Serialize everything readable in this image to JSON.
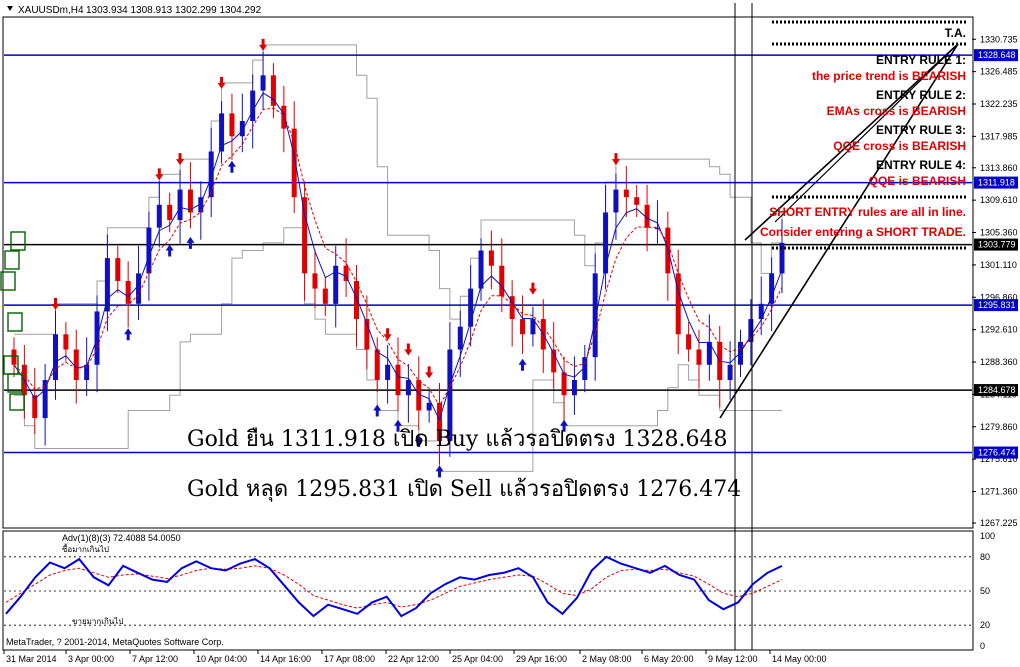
{
  "window": {
    "symbol_header": "XAUUSDm,H4",
    "ohlc": "1303.934 1308.913 1302.299 1304.292",
    "copyright": "MetaTrader, ? 2001-2014, MetaQuotes Software Corp."
  },
  "annotations": {
    "ta_label": "T.A.",
    "rules": [
      {
        "title": "ENTRY RULE 1:",
        "text": "the price trend is BEARISH"
      },
      {
        "title": "ENTRY RULE 2:",
        "text": "EMAs cross is BEARISH"
      },
      {
        "title": "ENTRY RULE 3:",
        "text": "QQE cross is BEARISH"
      },
      {
        "title": "ENTRY RULE 4:",
        "text": "QQE is BEARISH"
      }
    ],
    "short_entry_1": "SHORT ENTRY rules are all in line.",
    "short_entry_2": "Consider entering a SHORT TRADE.",
    "thai_line_1": "Gold ยืน 1311.918 เปิด Buy แล้วรอปิดตรง 1328.648",
    "thai_line_2": "Gold หลุด 1295.831 เปิด Sell แล้วรอปิดตรง 1276.474"
  },
  "colors": {
    "candle_bull": "#1010c0",
    "candle_bear": "#e00000",
    "hline_blue": "#0000c8",
    "hline_black": "#000000",
    "band": "#a0a0a0",
    "rule_red": "#e00000",
    "osc_main": "#0000e0",
    "osc_signal": "#e00000"
  },
  "chart_data": {
    "type": "line",
    "title": "XAUUSDm,H4",
    "ylim": [
      1267.225,
      1333.0
    ],
    "price_ticks": [
      "1330.735",
      "1326.485",
      "1322.235",
      "1317.985",
      "1313.860",
      "1309.610",
      "1305.360",
      "1301.110",
      "1296.860",
      "1292.610",
      "1288.360",
      "1284.110",
      "1279.860",
      "1275.610",
      "1271.360",
      "1267.225"
    ],
    "x_ticks": [
      "31 Mar 2014",
      "3 Apr 00:00",
      "7 Apr 12:00",
      "10 Apr 04:00",
      "14 Apr 16:00",
      "17 Apr 08:00",
      "22 Apr 12:00",
      "25 Apr 04:00",
      "29 Apr 16:00",
      "2 May 08:00",
      "6 May 20:00",
      "9 May 12:00",
      "14 May 00:00"
    ],
    "horizontal_levels": [
      {
        "value": 1328.648,
        "label": "1328.648",
        "color": "#0000c8"
      },
      {
        "value": 1311.918,
        "label": "1311.918",
        "color": "#0000c8"
      },
      {
        "value": 1303.779,
        "label": "1303.779",
        "color": "#000000"
      },
      {
        "value": 1295.831,
        "label": "1295.831",
        "color": "#0000c8"
      },
      {
        "value": 1284.678,
        "label": "1284.678",
        "color": "#000000"
      },
      {
        "value": 1276.474,
        "label": "1276.474",
        "color": "#0000c8"
      }
    ],
    "close_series": [
      1288,
      1284,
      1281,
      1286,
      1292,
      1290,
      1286,
      1288,
      1295,
      1302,
      1299,
      1296,
      1300,
      1306,
      1309,
      1307,
      1311,
      1308,
      1310,
      1316,
      1321,
      1318,
      1320,
      1324,
      1326,
      1322,
      1319,
      1310,
      1300,
      1298,
      1296,
      1301,
      1299,
      1294,
      1290,
      1286,
      1288,
      1284,
      1286,
      1282,
      1283,
      1278,
      1290,
      1293,
      1298,
      1303,
      1301,
      1297,
      1294,
      1292,
      1294,
      1290,
      1287,
      1284,
      1286,
      1289,
      1300,
      1308,
      1311,
      1310,
      1309,
      1306,
      1306,
      1300,
      1292,
      1290,
      1288,
      1291,
      1286,
      1288,
      1291,
      1294,
      1296,
      1300,
      1304
    ],
    "oscillator": {
      "label": "Adv(1)(8)(3) 72.4088 54.0050",
      "upper_label": "ซื้อมากเกินไป",
      "lower_label": "ขายมากเกินไป",
      "ticks": [
        "100",
        "80",
        "50",
        "20",
        "0"
      ],
      "main": [
        30,
        45,
        62,
        75,
        70,
        78,
        62,
        55,
        72,
        66,
        60,
        58,
        70,
        76,
        70,
        68,
        74,
        78,
        70,
        55,
        40,
        28,
        38,
        34,
        30,
        40,
        45,
        28,
        35,
        48,
        56,
        62,
        60,
        64,
        66,
        70,
        62,
        40,
        30,
        44,
        68,
        80,
        74,
        70,
        66,
        72,
        64,
        60,
        42,
        34,
        40,
        56,
        66,
        72
      ],
      "signal": [
        40,
        48,
        56,
        64,
        68,
        70,
        66,
        62,
        64,
        65,
        63,
        61,
        64,
        68,
        70,
        69,
        70,
        72,
        70,
        64,
        56,
        46,
        42,
        38,
        35,
        38,
        40,
        36,
        38,
        42,
        48,
        54,
        57,
        60,
        62,
        64,
        63,
        56,
        48,
        46,
        52,
        62,
        68,
        69,
        68,
        69,
        66,
        63,
        56,
        48,
        45,
        48,
        54,
        60
      ]
    }
  }
}
